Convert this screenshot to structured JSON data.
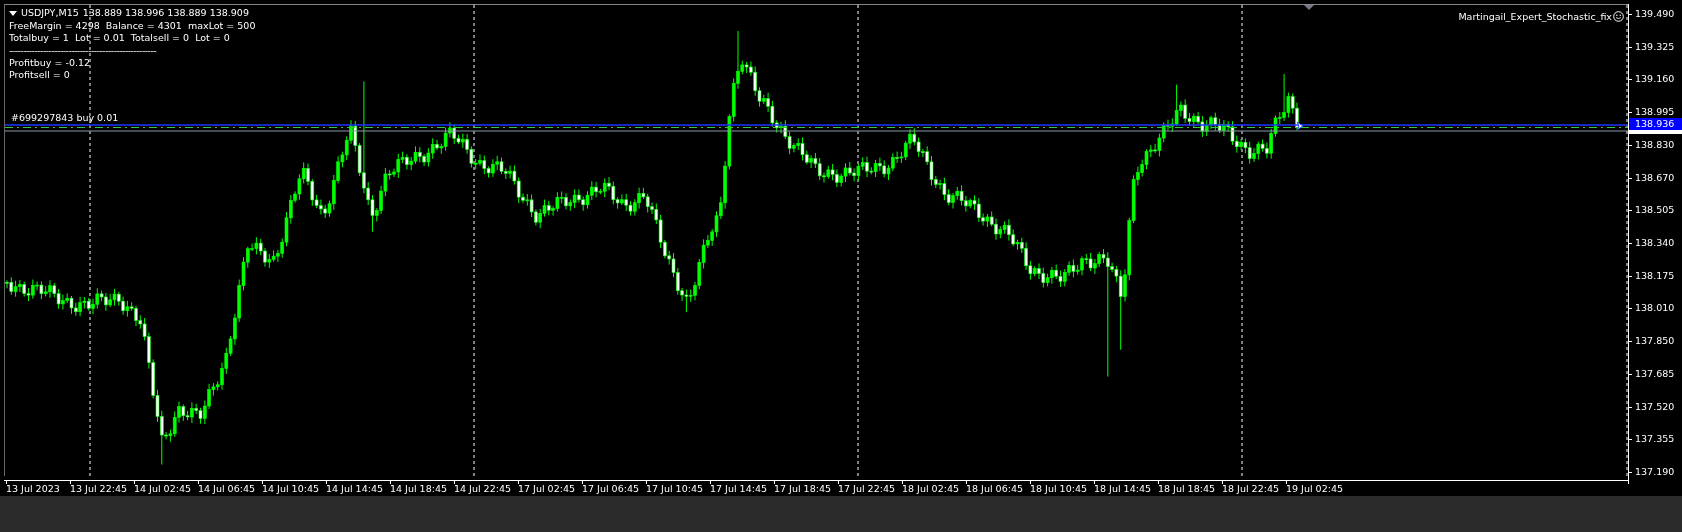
{
  "chart": {
    "symbol": "USDJPY,M15",
    "ohlc": "138.889 138.996 138.889 138.909",
    "info_lines": [
      "FreeMargin = 4298  Balance = 4301  maxLot = 500",
      "Totalbuy = 1  Lot = 0.01  Totalsell = 0  Lot = 0",
      "----------------------------------------------------",
      "Profitbuy = -0.12",
      "Profitsell = 0"
    ],
    "expert_name": "Martingail_Expert_Stochastic_fix",
    "order_label": "#699297843 buy 0.01"
  },
  "price_axis": {
    "ticks": [
      "139.490",
      "139.325",
      "139.160",
      "138.995",
      "138.830",
      "138.670",
      "138.505",
      "138.340",
      "138.175",
      "138.010",
      "137.850",
      "137.685",
      "137.520",
      "137.355",
      "137.190"
    ],
    "current_price": "138.936"
  },
  "time_axis": {
    "labels": [
      "13 Jul 2023",
      "13 Jul 22:45",
      "14 Jul 02:45",
      "14 Jul 06:45",
      "14 Jul 10:45",
      "14 Jul 14:45",
      "14 Jul 18:45",
      "14 Jul 22:45",
      "17 Jul 02:45",
      "17 Jul 06:45",
      "17 Jul 10:45",
      "17 Jul 14:45",
      "17 Jul 18:45",
      "17 Jul 22:45",
      "18 Jul 02:45",
      "18 Jul 06:45",
      "18 Jul 10:45",
      "18 Jul 14:45",
      "18 Jul 18:45",
      "18 Jul 22:45",
      "19 Jul 02:45"
    ]
  }
}
